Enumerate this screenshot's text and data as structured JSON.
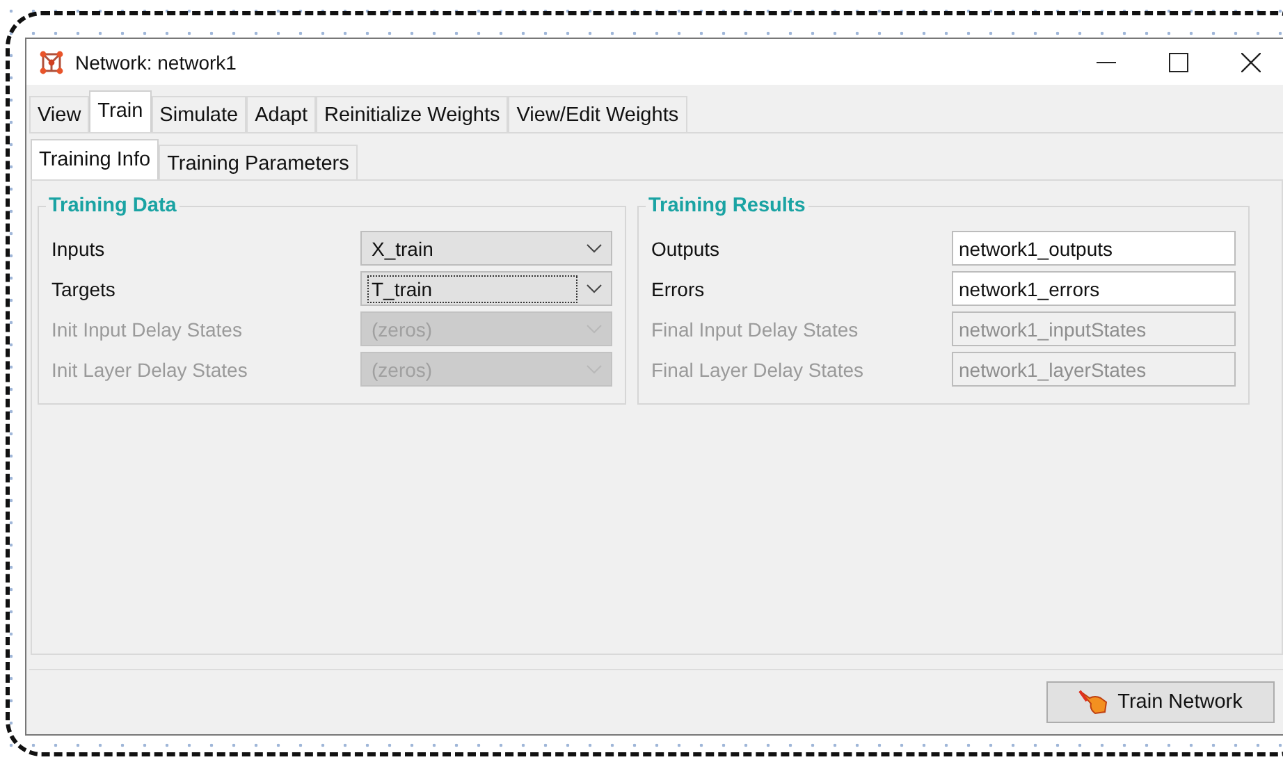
{
  "window": {
    "title": "Network: network1"
  },
  "tabs": [
    {
      "label": "View",
      "selected": false
    },
    {
      "label": "Train",
      "selected": true
    },
    {
      "label": "Simulate",
      "selected": false
    },
    {
      "label": "Adapt",
      "selected": false
    },
    {
      "label": "Reinitialize Weights",
      "selected": false
    },
    {
      "label": "View/Edit Weights",
      "selected": false
    }
  ],
  "subtabs": [
    {
      "label": "Training Info",
      "selected": true
    },
    {
      "label": "Training Parameters",
      "selected": false
    }
  ],
  "training_data": {
    "title": "Training Data",
    "rows": [
      {
        "label": "Inputs",
        "value": "X_train",
        "disabled": false,
        "focused": false
      },
      {
        "label": "Targets",
        "value": "T_train",
        "disabled": false,
        "focused": true
      },
      {
        "label": "Init Input Delay States",
        "value": "(zeros)",
        "disabled": true,
        "focused": false
      },
      {
        "label": "Init Layer Delay States",
        "value": "(zeros)",
        "disabled": true,
        "focused": false
      }
    ]
  },
  "training_results": {
    "title": "Training Results",
    "rows": [
      {
        "label": "Outputs",
        "value": "network1_outputs",
        "disabled": false
      },
      {
        "label": "Errors",
        "value": "network1_errors",
        "disabled": false
      },
      {
        "label": "Final Input Delay States",
        "value": "network1_inputStates",
        "disabled": true
      },
      {
        "label": "Final Layer Delay States",
        "value": "network1_layerStates",
        "disabled": true
      }
    ]
  },
  "train_button": {
    "label": "Train Network"
  }
}
